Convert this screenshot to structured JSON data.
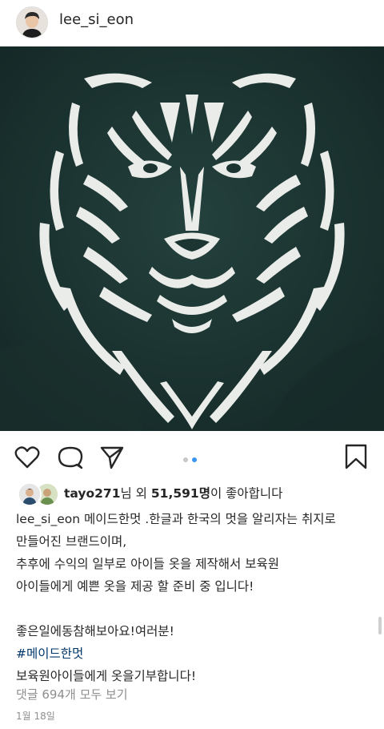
{
  "header": {
    "username": "lee_si_eon"
  },
  "actions": {
    "like_icon": "heart-outline-icon",
    "comment_icon": "speech-bubble-icon",
    "share_icon": "paper-plane-icon",
    "save_icon": "bookmark-icon",
    "carousel": {
      "count": 2,
      "active_index": 1
    }
  },
  "likes": {
    "user": "tayo271",
    "mid": "님 외 ",
    "count": "51,591명",
    "suffix": "이 좋아합니다"
  },
  "caption": {
    "username": "lee_si_eon",
    "line1": " 메이드한멋 .한글과 한국의 멋을 알리자는 취지로",
    "line2": "만들어진 브랜드이며,",
    "line3": "추후에 수익의 일부로 아이들 옷을 제작해서 보육원",
    "line4": "아이들에게 예쁜 옷을 제공 할 준비 중 입니다!",
    "line5": "좋은일에동참해보아요!여러분!",
    "hashtag": "#메이드한멋",
    "line6": "보육원아이들에게 옷을기부합니다!"
  },
  "comments_link": "댓글 694개 모두 보기",
  "date": "1월 18일",
  "colors": {
    "image_bg": "#1f3a36",
    "accent_dot": "#3897f0",
    "hashtag": "#00376b"
  }
}
